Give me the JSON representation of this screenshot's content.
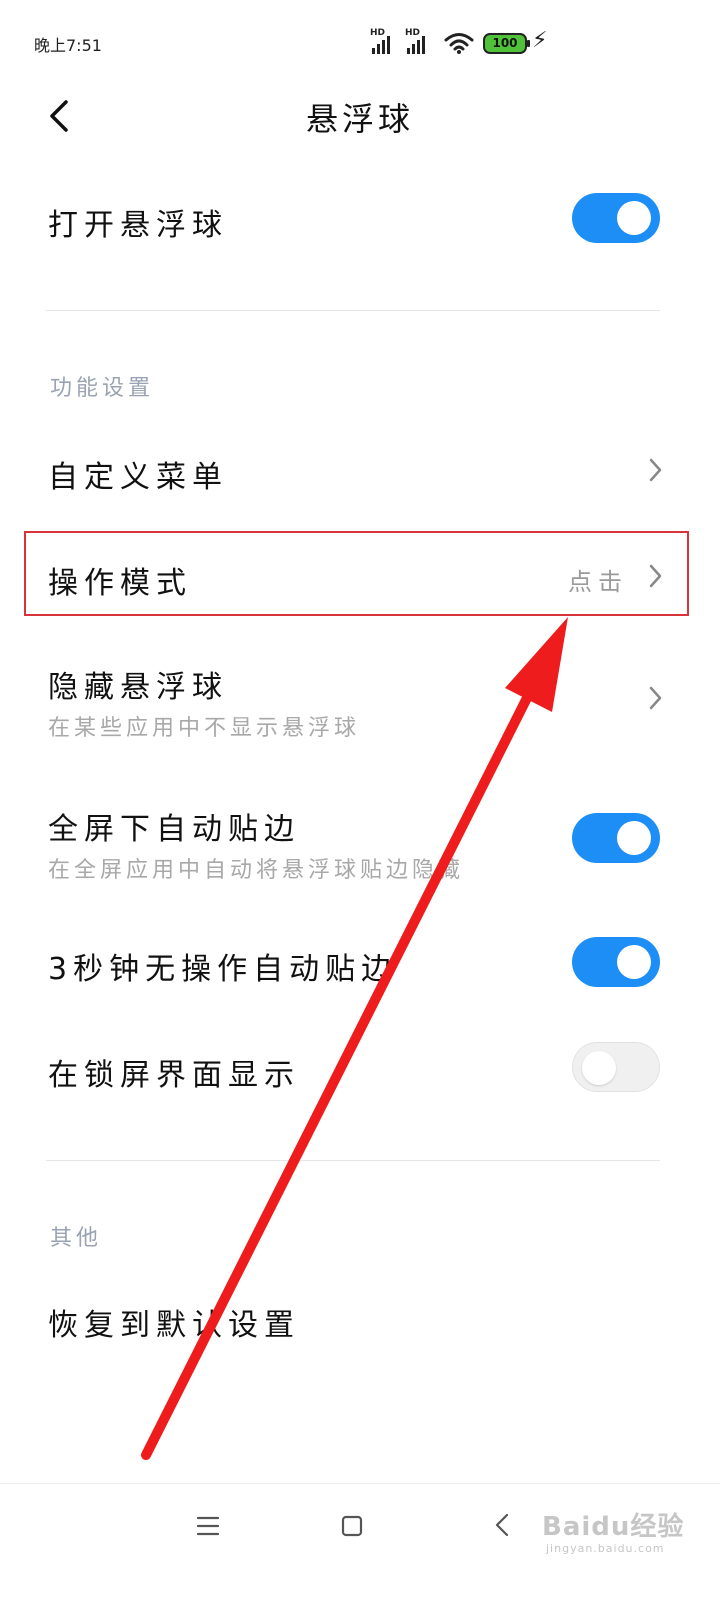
{
  "status_bar": {
    "time": "晚上7:51",
    "signal_label_1": "HD",
    "signal_label_2": "HD",
    "battery_level": "100",
    "icons": [
      "signal-icon",
      "signal-icon",
      "wifi-icon",
      "battery-icon",
      "charging-icon"
    ]
  },
  "header": {
    "title": "悬浮球",
    "back_icon": "chevron-left-icon"
  },
  "main": {
    "toggle_float_ball": {
      "label": "打开悬浮球",
      "on": true
    },
    "section_function": "功能设置",
    "custom_menu": {
      "label": "自定义菜单"
    },
    "operation_mode": {
      "label": "操作模式",
      "value": "点击"
    },
    "hide_float_ball": {
      "label": "隐藏悬浮球",
      "sub": "在某些应用中不显示悬浮球"
    },
    "fullscreen_auto_edge": {
      "label": "全屏下自动贴边",
      "sub": "在全屏应用中自动将悬浮球贴边隐藏",
      "on": true
    },
    "idle_auto_edge": {
      "label": "3秒钟无操作自动贴边",
      "on": true
    },
    "show_on_lockscreen": {
      "label": "在锁屏界面显示",
      "on": false
    },
    "section_other": "其他",
    "restore_default": {
      "label": "恢复到默认设置"
    }
  },
  "nav_bar": {
    "icons": [
      "menu-icon",
      "home-icon",
      "back-icon"
    ]
  },
  "watermark": {
    "text": "Baidu经验",
    "sub": "jingyan.baidu.com"
  },
  "colors": {
    "accent": "#1e8ef7",
    "highlight": "#d9333a",
    "arrow": "#ee1c1c",
    "section": "#9aa3b3"
  }
}
